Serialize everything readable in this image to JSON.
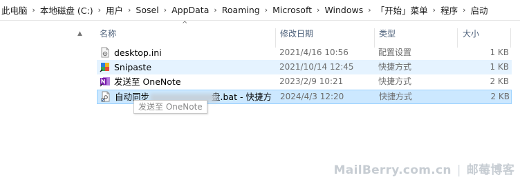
{
  "address_bar": {
    "crumbs": [
      "此电脑",
      "本地磁盘 (C:)",
      "用户",
      "Sosel",
      "AppData",
      "Roaming",
      "Microsoft",
      "Windows",
      "「开始」菜单",
      "程序",
      "启动"
    ]
  },
  "columns": {
    "name": "名称",
    "date": "修改日期",
    "type": "类型",
    "size": "大小"
  },
  "files": [
    {
      "name": "desktop.ini",
      "date": "2021/4/16 10:56",
      "type": "配置设置",
      "size": "1 KB",
      "icon": "settings-file-icon"
    },
    {
      "name": "Snipaste",
      "date": "2021/10/14 12:45",
      "type": "快捷方式",
      "size": "1 KB",
      "icon": "snipaste-icon"
    },
    {
      "name": "发送至 OneNote",
      "date": "2023/2/9 10:21",
      "type": "快捷方式",
      "size": "2 KB",
      "icon": "onenote-icon"
    },
    {
      "name_prefix": "自动同步",
      "name_suffix": "盘.bat - 快捷方...",
      "date": "2024/4/3 12:20",
      "type": "快捷方式",
      "size": "2 KB",
      "icon": "shortcut-file-icon"
    }
  ],
  "tooltip": "发送至 OneNote",
  "watermark": {
    "site": "MailBerry.com.cn",
    "separator": "|",
    "brand": "邮莓博客"
  },
  "colors": {
    "selected": "#cce8ff",
    "hover": "#e5f3ff",
    "header_text": "#4c607a"
  }
}
